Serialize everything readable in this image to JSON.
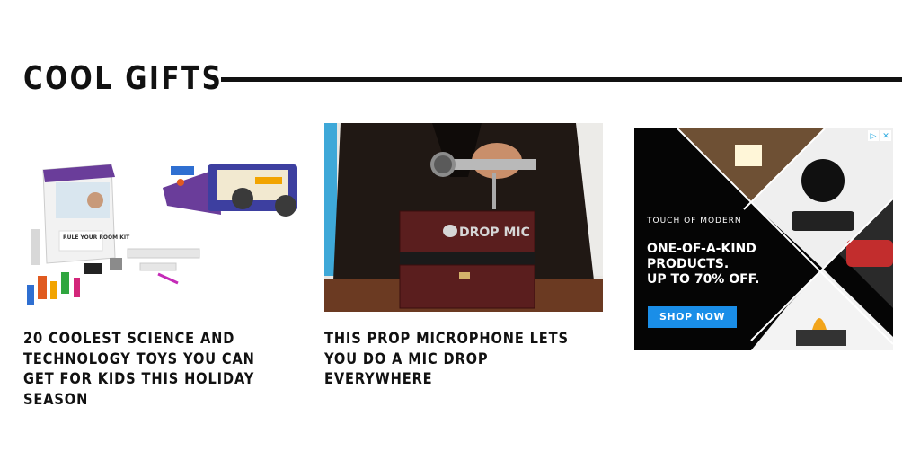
{
  "section": {
    "title": "COOL GIFTS"
  },
  "articles": [
    {
      "title": "20 COOLEST SCIENCE AND TECHNOLOGY TOYS YOU CAN GET FOR KIDS THIS HOLIDAY SEASON",
      "image_text": "RULE YOUR ROOM KIT"
    },
    {
      "title": "THIS PROP MICROPHONE LETS YOU DO A MIC DROP EVERYWHERE",
      "image_text": "DROP MIC"
    }
  ],
  "ad": {
    "brand": "TOUCH OF MODERN",
    "headline_lines": [
      "ONE-OF-A-KIND",
      "PRODUCTS.",
      "UP TO 70% OFF."
    ],
    "cta": "SHOP NOW",
    "accent_color": "#1a8ee8"
  }
}
